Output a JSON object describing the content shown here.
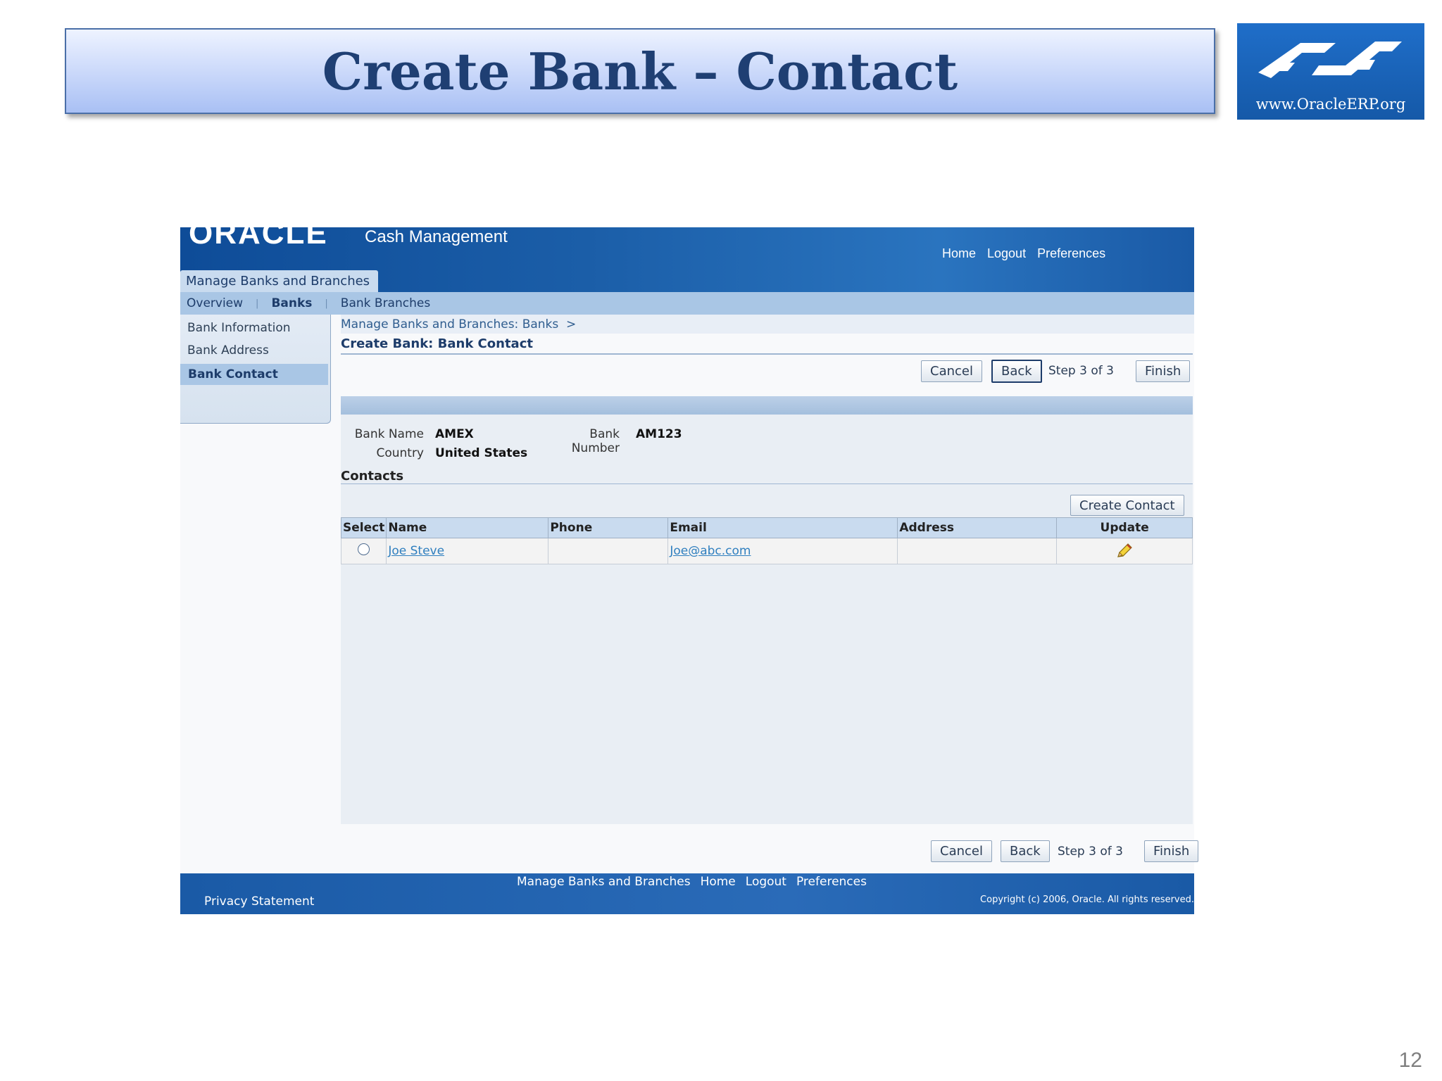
{
  "slide": {
    "title": "Create Bank – Contact",
    "logo_text": "www.OracleERP.org",
    "page_number": "12"
  },
  "app": {
    "brand": "ORACLE",
    "product": "Cash Management",
    "global_links": [
      "Home",
      "Logout",
      "Preferences"
    ],
    "main_tab": "Manage Banks and Branches",
    "subtabs": [
      "Overview",
      "Banks",
      "Bank Branches"
    ],
    "side_nav": [
      "Bank Information",
      "Bank Address",
      "Bank Contact"
    ],
    "breadcrumb": "Manage Banks and Branches: Banks  >",
    "page_heading": "Create Bank: Bank Contact",
    "buttons": {
      "cancel": "Cancel",
      "back": "Back",
      "finish": "Finish",
      "create_contact": "Create Contact"
    },
    "step_text": "Step 3 of 3",
    "bank_info": {
      "bank_name_label": "Bank Name",
      "bank_name": "AMEX",
      "bank_number_label": "Bank Number",
      "bank_number": "AM123",
      "country_label": "Country",
      "country": "United States"
    },
    "contacts_title": "Contacts",
    "table": {
      "headers": [
        "Select",
        "Name",
        "Phone",
        "Email",
        "Address",
        "Update"
      ],
      "rows": [
        {
          "name": "Joe Steve",
          "phone": "",
          "email": "Joe@abc.com",
          "address": ""
        }
      ]
    },
    "footer": {
      "links": [
        "Manage Banks and Branches",
        "Home",
        "Logout",
        "Preferences"
      ],
      "privacy": "Privacy Statement",
      "copyright": "Copyright (c) 2006, Oracle. All rights reserved."
    }
  },
  "colors": {
    "title": "#1f3f73",
    "header_blue": "#1b5ea8",
    "link": "#2f7fbf",
    "tab_light": "#c9dbef"
  },
  "icons": {
    "update": "pencil-icon",
    "logo": "handshake-logo-icon"
  }
}
